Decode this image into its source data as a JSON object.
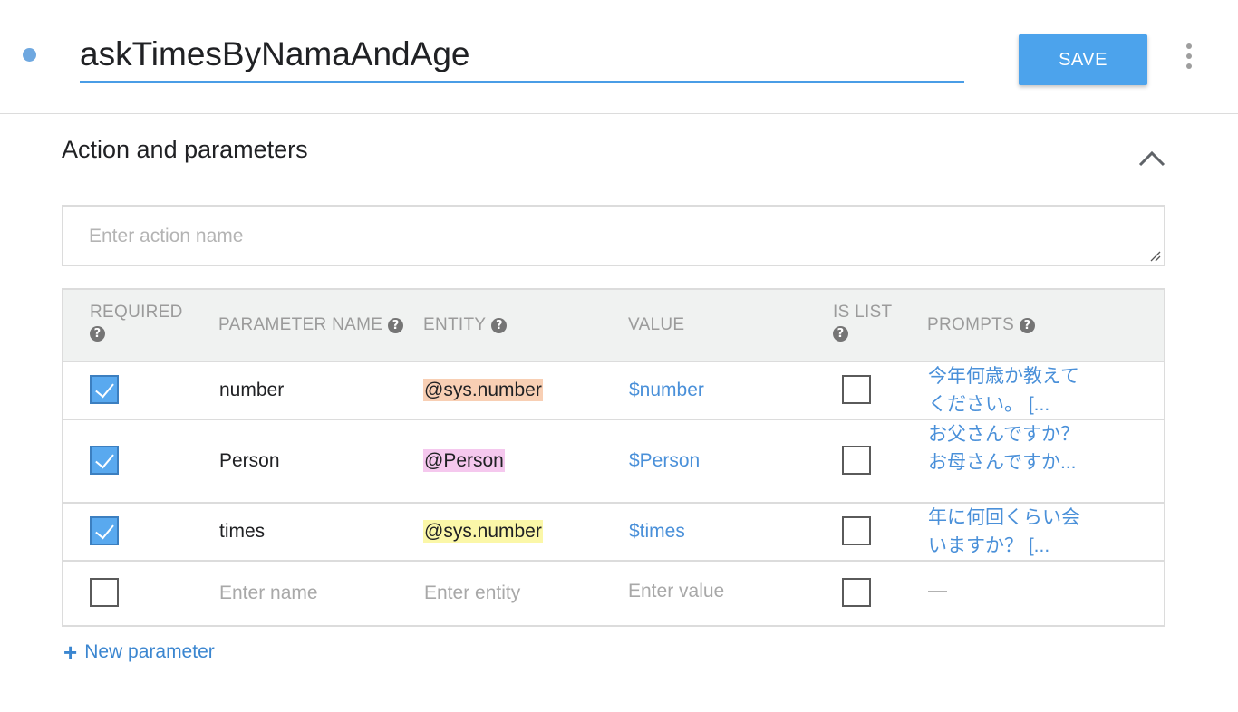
{
  "header": {
    "intent_name": "askTimesByNamaAndAge",
    "save_label": "SAVE"
  },
  "section": {
    "title": "Action and parameters",
    "action_placeholder": "Enter action name"
  },
  "table": {
    "headers": {
      "required": "REQUIRED",
      "parameter_name": "PARAMETER NAME",
      "entity": "ENTITY",
      "value": "VALUE",
      "is_list": "IS LIST",
      "prompts": "PROMPTS"
    },
    "help_glyph": "?",
    "rows": [
      {
        "required": true,
        "name": "number",
        "entity": "@sys.number",
        "entity_color": "#f8cfb4",
        "value": "$number",
        "is_list": false,
        "prompt": "今年何歳か教えてください。 [..."
      },
      {
        "required": true,
        "name": "Person",
        "entity": "@Person",
        "entity_color": "#f5c8ee",
        "value": "$Person",
        "is_list": false,
        "prompt": "お父さんですか？お母さんですか..."
      },
      {
        "required": true,
        "name": "times",
        "entity": "@sys.number",
        "entity_color": "#fbf7a8",
        "value": "$times",
        "is_list": false,
        "prompt": "年に何回くらい会いますか？ [..."
      }
    ],
    "new_row": {
      "name_placeholder": "Enter name",
      "entity_placeholder": "Enter entity",
      "value_placeholder": "Enter value",
      "prompt_placeholder": "—"
    }
  },
  "footer": {
    "new_parameter_plus": "+",
    "new_parameter_label": "New parameter"
  },
  "colors": {
    "accent": "#4ca3ec",
    "link": "#4a90d9",
    "checkbox_checked": "#59a9ef"
  }
}
